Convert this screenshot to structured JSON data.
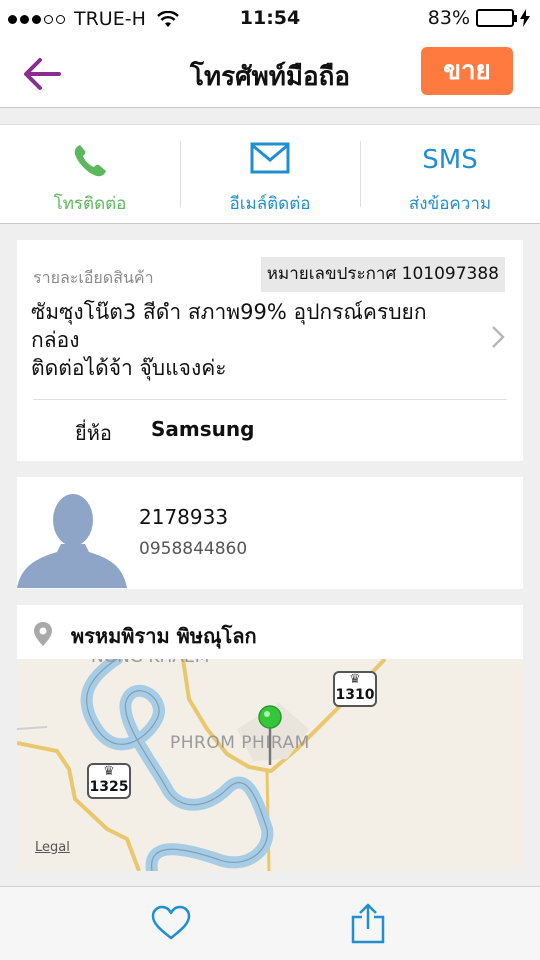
{
  "status_bar": {
    "carrier": "TRUE-H",
    "time": "11:54",
    "battery": "83%",
    "battery_level": 0.83
  },
  "nav": {
    "title": "โทรศัพท์มือถือ",
    "sell_label": "ขาย"
  },
  "contact": {
    "call_label": "โทรติดต่อ",
    "email_label": "อีเมล์ติดต่อ",
    "sms_icon_text": "SMS",
    "sms_label": "ส่งข้อความ"
  },
  "details": {
    "label": "รายละเอียดสินค้า",
    "ad_number": "หมายเลขประกาศ 101097388",
    "description": "ซัมซุงโน๊ต3 สีดำ สภาพ99% อุปกรณ์ครบยก\nกล่อง\nติดต่อได้จ้า จุ๊บแจงค่ะ",
    "brand_label": "ยี่ห้อ",
    "brand_value": "Samsung"
  },
  "seller": {
    "id": "2178933",
    "phone": "0958844860"
  },
  "location": {
    "text": "พรหมพิราม พิษณุโลก",
    "map_town": "PHROM PHIRAM",
    "map_town_top": "NONG KHAEM",
    "road_1310": "1310",
    "road_1325": "1325",
    "legal": "Legal"
  },
  "colors": {
    "accent_purple": "#8b2d8f",
    "sell_orange": "#ff7a3f",
    "call_green": "#5cb85c",
    "link_blue": "#1f8fd0"
  }
}
